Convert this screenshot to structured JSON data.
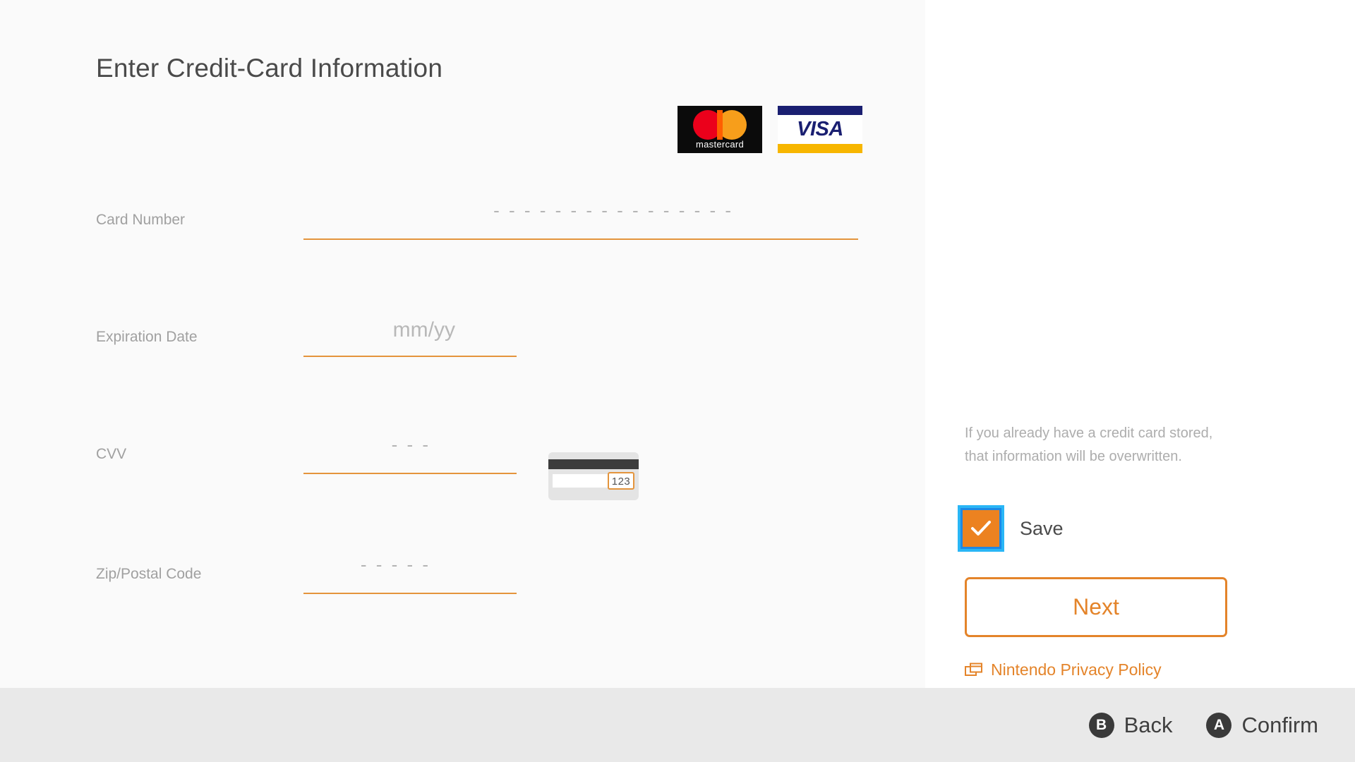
{
  "page_title": "Enter Credit-Card Information",
  "colors": {
    "accent_orange": "#e4842a",
    "underline_orange": "#e8953f",
    "checkbox_orange": "#ec8220",
    "focus_cyan": "#29b6f6",
    "label_gray": "#a0a0a0",
    "panel_bg": "#fafafa",
    "bottom_bar_bg": "#e9e9e9"
  },
  "brand_logos": [
    {
      "name": "mastercard",
      "label": "mastercard"
    },
    {
      "name": "visa",
      "label": "VISA"
    }
  ],
  "form": {
    "fields": [
      {
        "id": "card-number",
        "label": "Card Number",
        "value": "",
        "placeholder": "- - - -  - - - -  - - - -  - - - -",
        "width": "wide"
      },
      {
        "id": "expiration-date",
        "label": "Expiration Date",
        "value": "",
        "placeholder": "mm/yy",
        "width": "narrow"
      },
      {
        "id": "cvv",
        "label": "CVV",
        "value": "",
        "placeholder": "- - -",
        "width": "narrow"
      },
      {
        "id": "zip-postal-code",
        "label": "Zip/Postal Code",
        "value": "",
        "placeholder": "- - - - -",
        "width": "narrow"
      }
    ]
  },
  "cvv_hint_card": {
    "code_example": "123"
  },
  "side_panel": {
    "help_text": "If you already have a credit card stored, that information will be overwritten.",
    "save_checkbox": {
      "label": "Save",
      "checked": true,
      "focused": true
    },
    "next_button_label": "Next",
    "privacy_link": {
      "label": "Nintendo Privacy Policy",
      "icon": "external-window-icon"
    }
  },
  "bottom_bar": {
    "actions": [
      {
        "glyph": "B",
        "label": "Back"
      },
      {
        "glyph": "A",
        "label": "Confirm"
      }
    ]
  }
}
